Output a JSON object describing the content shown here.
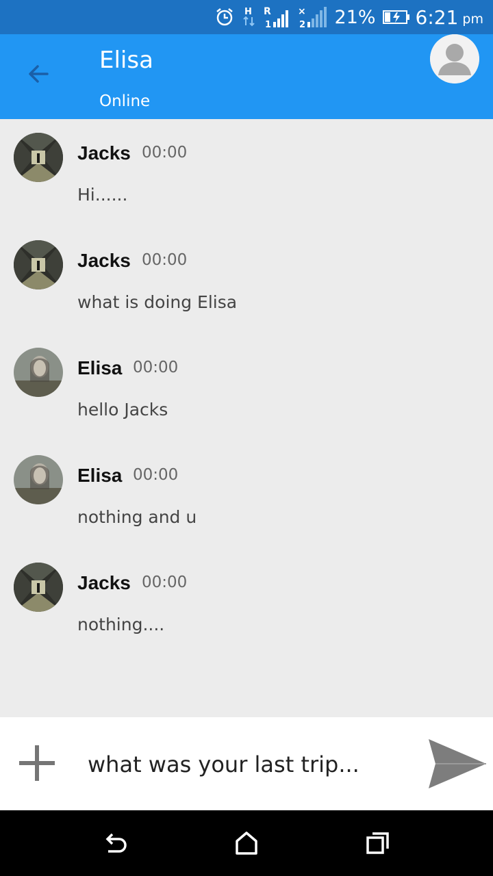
{
  "status_bar": {
    "icons": [
      "alarm-icon",
      "hspa-data-icon",
      "signal-sim1-icon",
      "signal-sim2-icon",
      "battery-charging-icon"
    ],
    "battery": "21%",
    "time": "6:21",
    "ampm": "pm"
  },
  "header": {
    "name": "Elisa",
    "status": "Online"
  },
  "messages": [
    {
      "sender": "Jacks",
      "time": "00:00",
      "text": "Hi......"
    },
    {
      "sender": "Jacks",
      "time": "00:00",
      "text": "what is doing Elisa"
    },
    {
      "sender": "Elisa",
      "time": "00:00",
      "text": "hello Jacks"
    },
    {
      "sender": "Elisa",
      "time": "00:00",
      "text": "nothing and u"
    },
    {
      "sender": "Jacks",
      "time": "00:00",
      "text": "nothing...."
    }
  ],
  "composer": {
    "value": "what was your last trip..."
  },
  "colors": {
    "status_bar": "#1d72c2",
    "app_bar": "#2196f3",
    "background": "#ececec"
  }
}
